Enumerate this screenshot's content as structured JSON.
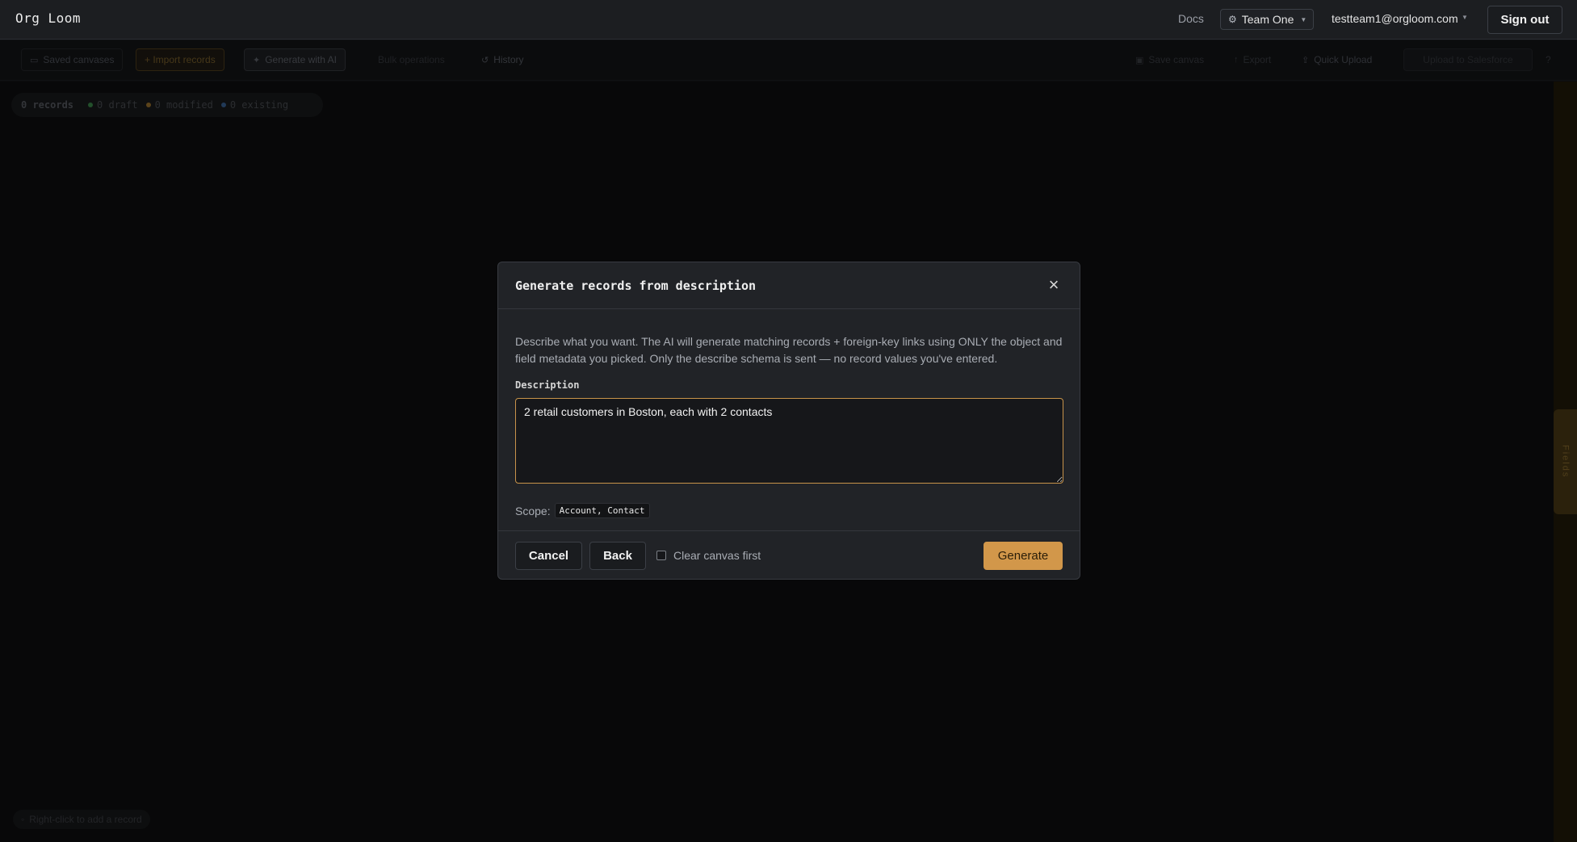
{
  "header": {
    "brand": "Org Loom",
    "docs_label": "Docs",
    "team_name": "Team One",
    "user_email": "testteam1@orgloom.com",
    "signout_label": "Sign out"
  },
  "toolbar": {
    "saved_canvases": "Saved canvases",
    "import_records": "+ Import records",
    "generate_ai": "Generate with AI",
    "bulk_operations": "Bulk operations",
    "history": "History",
    "save_canvas": "Save canvas",
    "export": "Export",
    "quick_upload": "Quick Upload",
    "upload_salesforce": "Upload to Salesforce",
    "help": "?"
  },
  "canvas": {
    "record_count": "0 records",
    "draft": "0 draft",
    "modified": "0 modified",
    "existing": "0 existing",
    "hint": "Right-click to add a record",
    "side_panel": "Fields"
  },
  "colors": {
    "accent": "#d2974a",
    "draft_dot": "#2f6b3a",
    "modified_dot": "#7a5a23",
    "existing_dot": "#2d4d75"
  },
  "modal": {
    "title": "Generate records from description",
    "description": "Describe what you want. The AI will generate matching records + foreign-key links using ONLY the object and field metadata you picked. Only the describe schema is sent — no record values you've entered.",
    "field_label": "Description",
    "textarea_value": "2 retail customers in Boston, each with 2 contacts",
    "scope_label": "Scope:",
    "scope_value": "Account, Contact",
    "cancel_label": "Cancel",
    "back_label": "Back",
    "clear_label": "Clear canvas first",
    "generate_label": "Generate"
  }
}
